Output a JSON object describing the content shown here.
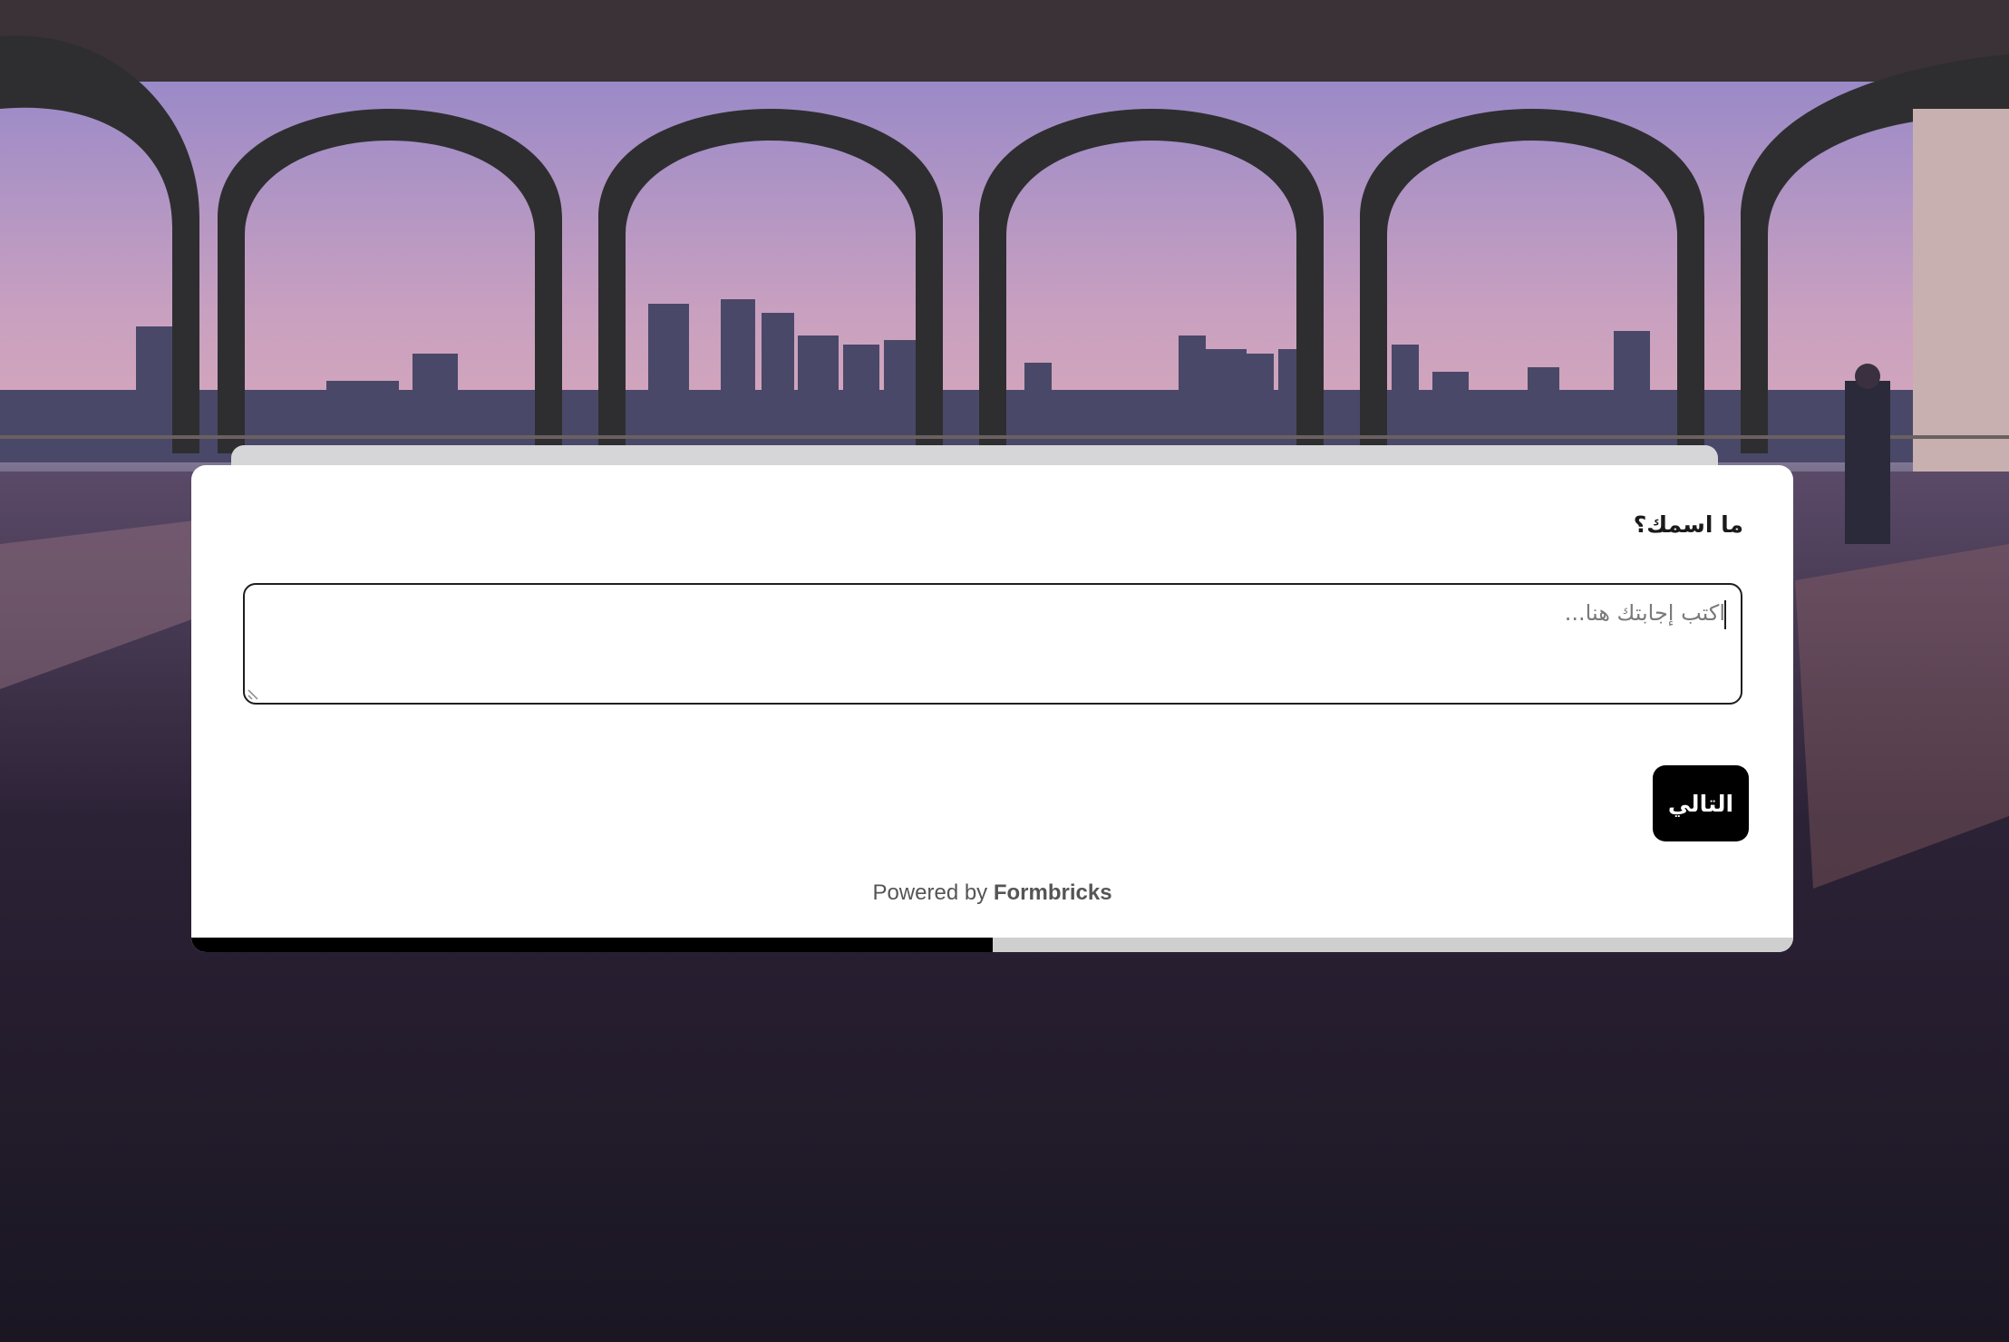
{
  "survey": {
    "question": "ما اسمك؟",
    "answer_placeholder": "اكتب إجابتك هنا...",
    "answer_value": "",
    "next_label": "التالي",
    "powered_prefix": "Powered by ",
    "powered_brand": "Formbricks",
    "progress": 0.5
  },
  "colors": {
    "button_bg": "#000000",
    "progress_fill": "#000000",
    "progress_track": "#cfcfcf",
    "card_bg": "#ffffff"
  }
}
